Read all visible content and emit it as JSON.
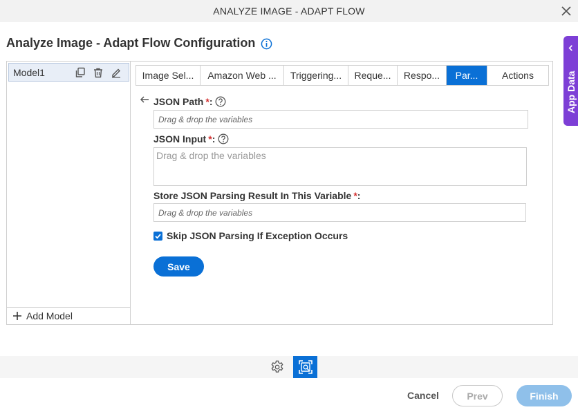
{
  "window": {
    "title": "ANALYZE IMAGE - ADAPT FLOW"
  },
  "heading": {
    "title": "Analyze Image - Adapt Flow Configuration"
  },
  "app_data": {
    "label": "App Data"
  },
  "models": {
    "items": [
      {
        "name": "Model1"
      }
    ],
    "add_label": "Add Model"
  },
  "tabs": [
    {
      "label": "Image Sel..."
    },
    {
      "label": "Amazon Web ..."
    },
    {
      "label": "Triggering..."
    },
    {
      "label": "Reque..."
    },
    {
      "label": "Respo..."
    },
    {
      "label": "Par...",
      "active": true
    },
    {
      "label": "Actions"
    }
  ],
  "form": {
    "json_path": {
      "label": "JSON Path",
      "required": "*",
      "colon": ":",
      "placeholder": "Drag & drop the variables"
    },
    "json_input": {
      "label": "JSON Input",
      "required": "*",
      "colon": ":",
      "placeholder": "Drag & drop the variables"
    },
    "store_result": {
      "label": "Store JSON Parsing Result In This Variable",
      "required": "*",
      "colon": ":",
      "placeholder": "Drag & drop the variables"
    },
    "skip_exception": {
      "label": "Skip JSON Parsing If Exception Occurs",
      "checked": true
    },
    "save_label": "Save"
  },
  "footer": {
    "cancel_label": "Cancel",
    "prev_label": "Prev",
    "finish_label": "Finish"
  },
  "colors": {
    "accent": "#0a70d6",
    "app_data_bg": "#7d3fd6",
    "required": "#d32f2f",
    "finish_disabled": "#8fc0ea"
  }
}
